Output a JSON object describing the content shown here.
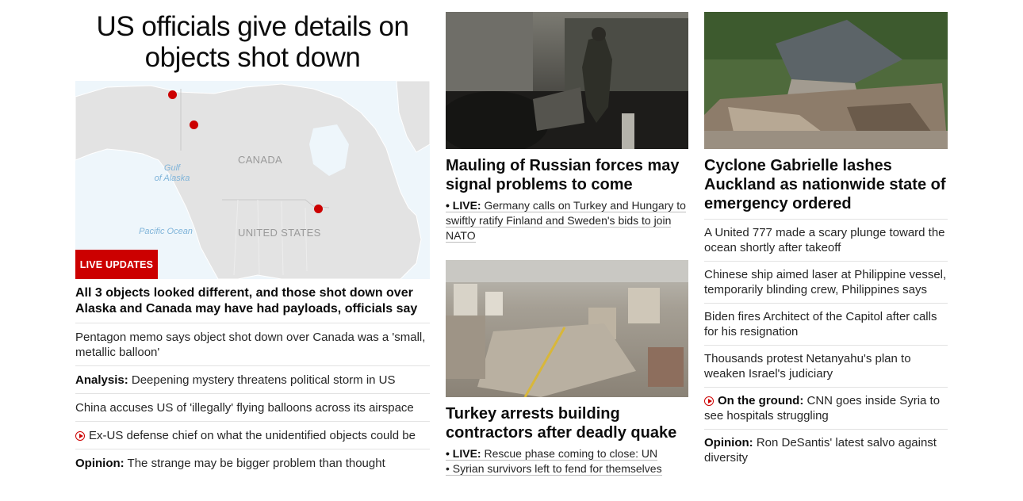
{
  "col1": {
    "headline": "US officials give details on objects shot down",
    "map": {
      "label_canada": "CANADA",
      "label_us": "UNITED STATES",
      "label_gulf": "Gulf of Alaska",
      "label_gulf_l1": "Gulf",
      "label_gulf_l2": "of Alaska",
      "label_pacific": "Pacific Ocean"
    },
    "badge": "LIVE UPDATES",
    "lead": "All 3 objects looked different, and those shot down over Alaska and Canada may have had payloads, officials say",
    "items": [
      {
        "prefix": "",
        "text": "Pentagon memo says object shot down over Canada was a 'small, metallic balloon'",
        "video": false
      },
      {
        "prefix": "Analysis:",
        "text": " Deepening mystery threatens political storm in US",
        "video": false
      },
      {
        "prefix": "",
        "text": "China accuses US of 'illegally' flying balloons across its airspace",
        "video": false
      },
      {
        "prefix": "",
        "text": "Ex-US defense chief on what the unidentified objects could be",
        "video": true
      },
      {
        "prefix": "Opinion:",
        "text": " The strange may be bigger problem than thought",
        "video": false
      }
    ]
  },
  "col2": {
    "story1": {
      "headline": "Mauling of Russian forces may signal problems to come",
      "sub_prefix": "• LIVE:",
      "sub_l1": " Germany calls on Turkey and Hungary to",
      "sub_l2": "swiftly ratify Finland and Sweden's bids to join",
      "sub_l3": "NATO"
    },
    "story2": {
      "headline": "Turkey arrests building contractors after deadly quake",
      "sub1_prefix": "• LIVE:",
      "sub1_text": " Rescue phase coming to close: UN",
      "sub2_text": "• Syrian survivors left to fend for themselves"
    }
  },
  "col3": {
    "headline": "Cyclone Gabrielle lashes Auckland as nationwide state of emergency ordered",
    "items": [
      {
        "prefix": "",
        "text": "A United 777 made a scary plunge toward the ocean shortly after takeoff",
        "video": false
      },
      {
        "prefix": "",
        "text": "Chinese ship aimed laser at Philippine vessel, temporarily blinding crew, Philippines says",
        "video": false
      },
      {
        "prefix": "",
        "text": "Biden fires Architect of the Capitol after calls for his resignation",
        "video": false
      },
      {
        "prefix": "",
        "text": "Thousands protest Netanyahu's plan to weaken Israel's judiciary",
        "video": false
      },
      {
        "prefix": "On the ground:",
        "text": " CNN goes inside Syria to see hospitals struggling",
        "video": true
      },
      {
        "prefix": "Opinion:",
        "text": " Ron DeSantis' latest salvo against diversity",
        "video": false
      }
    ]
  },
  "colors": {
    "accent": "#cc0000",
    "divider": "#e2e2e2"
  }
}
